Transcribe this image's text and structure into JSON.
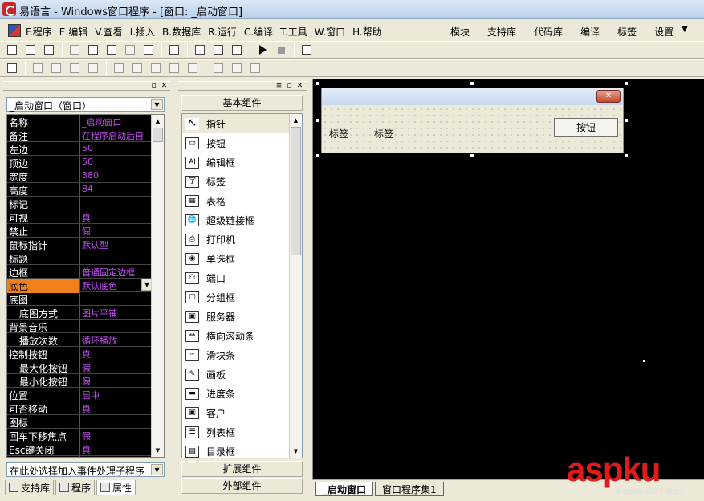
{
  "window": {
    "title": "易语言 - Windows窗口程序 - [窗口: _启动窗口]"
  },
  "menu": {
    "items": [
      "F.程序",
      "E.编辑",
      "V.查看",
      "I.插入",
      "B.数据库",
      "R.运行",
      "C.编译",
      "T.工具",
      "W.窗口",
      "H.帮助"
    ],
    "right_items": [
      "模块",
      "支持库",
      "代码库",
      "编译",
      "标签",
      "设置"
    ]
  },
  "properties": {
    "object_select": "_启动窗口（窗口）",
    "rows": [
      {
        "k": "名称",
        "v": "_启动窗口",
        "sub": false
      },
      {
        "k": "备注",
        "v": "在程序启动后自",
        "sub": false
      },
      {
        "k": "左边",
        "v": "50",
        "sub": false
      },
      {
        "k": "顶边",
        "v": "50",
        "sub": false
      },
      {
        "k": "宽度",
        "v": "380",
        "sub": false
      },
      {
        "k": "高度",
        "v": "84",
        "sub": false
      },
      {
        "k": "标记",
        "v": "",
        "sub": false
      },
      {
        "k": "可视",
        "v": "真",
        "sub": false
      },
      {
        "k": "禁止",
        "v": "假",
        "sub": false
      },
      {
        "k": "鼠标指针",
        "v": "默认型",
        "sub": false
      },
      {
        "k": "标题",
        "v": "",
        "sub": false
      },
      {
        "k": "边框",
        "v": "普通固定边框",
        "sub": false
      },
      {
        "k": "底色",
        "v": "默认底色",
        "sub": false
      },
      {
        "k": "底图",
        "v": "",
        "sub": false
      },
      {
        "k": "底图方式",
        "v": "图片平铺",
        "sub": true
      },
      {
        "k": "背景音乐",
        "v": "",
        "sub": false
      },
      {
        "k": "播放次数",
        "v": "循环播放",
        "sub": true
      },
      {
        "k": "控制按钮",
        "v": "真",
        "sub": false
      },
      {
        "k": "最大化按钮",
        "v": "假",
        "sub": true
      },
      {
        "k": "最小化按钮",
        "v": "假",
        "sub": true
      },
      {
        "k": "位置",
        "v": "居中",
        "sub": false
      },
      {
        "k": "可否移动",
        "v": "真",
        "sub": false
      },
      {
        "k": "图标",
        "v": "",
        "sub": false
      },
      {
        "k": "回车下移焦点",
        "v": "假",
        "sub": false
      },
      {
        "k": "Esc键关闭",
        "v": "真",
        "sub": false
      }
    ],
    "event_select": "在此处选择加入事件处理子程序"
  },
  "left_tabs": [
    "支持库",
    "程序",
    "属性"
  ],
  "components": {
    "group_basic": "基本组件",
    "items": [
      "指针",
      "按钮",
      "编辑框",
      "标签",
      "表格",
      "超级链接框",
      "打印机",
      "单选框",
      "端口",
      "分组框",
      "服务器",
      "横向滚动条",
      "滑块条",
      "画板",
      "进度条",
      "客户",
      "列表框",
      "目录框"
    ],
    "icons": [
      "↖",
      "▭",
      "AI",
      "字",
      "▦",
      "🌐",
      "⎙",
      "◉",
      "⚇",
      "▢",
      "▣",
      "⇔",
      "┄",
      "✎",
      "▬",
      "▣",
      "☰",
      "▤"
    ],
    "group_ext": "扩展组件",
    "group_external": "外部组件"
  },
  "design": {
    "close_glyph": "✕",
    "label1": "标签",
    "label2": "标签",
    "button": "按钮"
  },
  "canvas_tabs": [
    "_启动窗口",
    "窗口程序集1"
  ],
  "watermark": {
    "logo": "aspku",
    "sub": "免费网站源码下载站!"
  }
}
